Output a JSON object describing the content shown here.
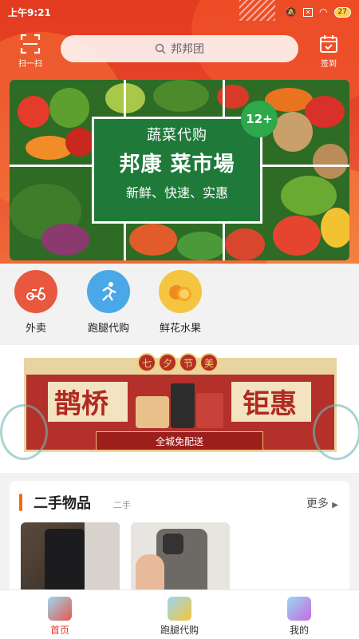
{
  "status_bar": {
    "time": "上午9:21",
    "battery": "27"
  },
  "header": {
    "scan_label": "扫一扫",
    "search_placeholder": "邦邦团",
    "checkin_label": "签到"
  },
  "banner": {
    "line1": "蔬菜代购",
    "line2": "邦康  菜市場",
    "line3": "新鲜、快速、实惠",
    "age_badge": "12+"
  },
  "quick_links": [
    {
      "label": "外卖",
      "icon": "scooter-icon",
      "color": "#e9573f"
    },
    {
      "label": "跑腿代购",
      "icon": "runner-icon",
      "color": "#4aa8e8"
    },
    {
      "label": "鲜花水果",
      "icon": "orange-icon",
      "color": "#f5a623"
    }
  ],
  "festival": {
    "tag": [
      "七",
      "夕",
      "节",
      "美"
    ],
    "left_text": "鹊桥",
    "right_text": "钜惠",
    "ribbon": "全城免配送"
  },
  "second_hand": {
    "title": "二手物品",
    "subtitle": "二手",
    "more": "更多"
  },
  "bottom_nav": [
    {
      "label": "首页",
      "active": true
    },
    {
      "label": "跑腿代购",
      "active": false
    },
    {
      "label": "我的",
      "active": false
    }
  ],
  "colors": {
    "brand_red": "#e33b20",
    "accent_orange": "#f06a1a",
    "board_green": "#1f7a3a"
  }
}
